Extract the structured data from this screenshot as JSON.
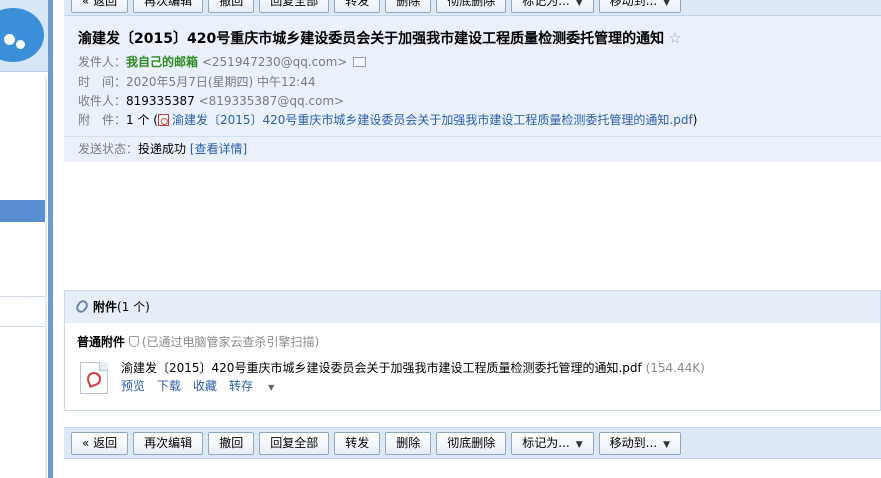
{
  "toolbar": {
    "back": "« 返回",
    "edit_again": "再次编辑",
    "withdraw": "撤回",
    "reply_all": "回复全部",
    "forward": "转发",
    "delete": "删除",
    "delete_permanently": "彻底删除",
    "mark_as": "标记为...",
    "move_to": "移动到..."
  },
  "email": {
    "subject": "渝建发〔2015〕420号重庆市城乡建设委员会关于加强我市建设工程质量检测委托管理的通知",
    "star": "☆",
    "sender_label": "发件人：",
    "sender_name": "我自己的邮箱",
    "sender_addr": "<251947230@qq.com>",
    "time_label": "时　间：",
    "time_value": "2020年5月7日(星期四) 中午12:44",
    "recipient_label": "收件人：",
    "recipient_name": "819335387",
    "recipient_addr": "<819335387@qq.com>",
    "attach_label": "附　件：",
    "attach_count": "1 个 (",
    "attach_name": "渝建发〔2015〕420号重庆市城乡建设委员会关于加强我市建设工程质量检测委托管理的通知.pdf",
    "attach_close": ")",
    "status_label": "发送状态：",
    "status_value": "投递成功",
    "status_link": "[查看详情]"
  },
  "attachments": {
    "title": "附件",
    "count": "(1 个)",
    "section_label": "普通附件",
    "scan_note": "(已通过电脑管家云查杀引擎扫描)",
    "file_name": "渝建发〔2015〕420号重庆市城乡建设委员会关于加强我市建设工程质量检测委托管理的通知.pdf",
    "file_size": "(154.44K)",
    "actions": {
      "preview": "预览",
      "download": "下载",
      "favorite": "收藏",
      "save_to": "转存"
    }
  },
  "icons": {
    "star": "star-icon",
    "vcard": "contact-card-icon",
    "pdf": "pdf-file-icon",
    "clip": "paperclip-icon",
    "shield": "shield-icon"
  }
}
